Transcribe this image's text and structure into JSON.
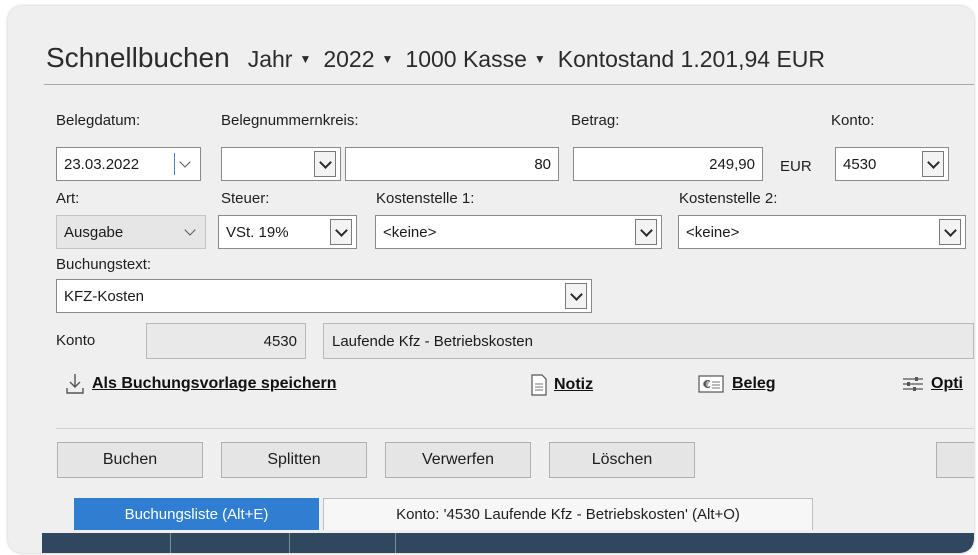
{
  "header": {
    "title": "Schnellbuchen",
    "period": "Jahr",
    "year": "2022",
    "account": "1000 Kasse",
    "balance": "Kontostand 1.201,94 EUR"
  },
  "form": {
    "belegdatum": {
      "label": "Belegdatum:",
      "value": "23.03.2022"
    },
    "belegnummernkreis": {
      "label": "Belegnummernkreis:",
      "value": "",
      "number": "80"
    },
    "betrag": {
      "label": "Betrag:",
      "value": "249,90",
      "currency": "EUR"
    },
    "konto": {
      "label": "Konto:",
      "value": "4530"
    },
    "art": {
      "label": "Art:",
      "value": "Ausgabe"
    },
    "steuer": {
      "label": "Steuer:",
      "value": "VSt. 19%"
    },
    "kostenstelle1": {
      "label": "Kostenstelle 1:",
      "value": "<keine>"
    },
    "kostenstelle2": {
      "label": "Kostenstelle 2:",
      "value": "<keine>"
    },
    "buchungstext": {
      "label": "Buchungstext:",
      "value": "KFZ-Kosten"
    },
    "konto_info": {
      "label": "Konto",
      "number": "4530",
      "name": "Laufende Kfz - Betriebskosten"
    }
  },
  "actions": {
    "vorlage": "Als Buchungsvorlage speichern",
    "notiz": "Notiz",
    "beleg": "Beleg",
    "optionen": "Opti"
  },
  "buttons": {
    "buchen": "Buchen",
    "splitten": "Splitten",
    "verwerfen": "Verwerfen",
    "loeschen": "Löschen"
  },
  "tabs": [
    {
      "label": "Buchungsliste (Alt+E)",
      "active": true
    },
    {
      "label": "Konto: '4530 Laufende Kfz - Betriebskosten' (Alt+O)",
      "active": false
    }
  ],
  "colors": {
    "accent": "#2f7ed1",
    "grid_header": "#2f4860"
  }
}
